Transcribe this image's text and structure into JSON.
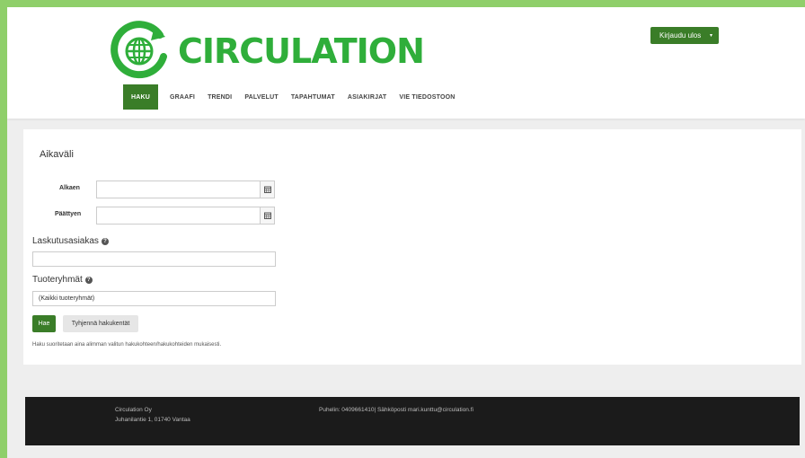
{
  "brand": {
    "name": "CIRCULATION",
    "logo_icon": "globe-arrow-icon",
    "color": "#2fae3a"
  },
  "account": {
    "logout_label": "Kirjaudu ulos",
    "caret": "▾"
  },
  "nav": {
    "items": [
      {
        "label": "HAKU",
        "active": true
      },
      {
        "label": "GRAAFI"
      },
      {
        "label": "TRENDI"
      },
      {
        "label": "PALVELUT"
      },
      {
        "label": "TAPAHTUMAT"
      },
      {
        "label": "ASIAKIRJAT"
      },
      {
        "label": "VIE TIEDOSTOON"
      }
    ]
  },
  "search": {
    "period_title": "Aikaväli",
    "start_label": "Alkaen",
    "start_value": "",
    "end_label": "Päättyen",
    "end_value": "",
    "calendar_icon": "calendar-icon",
    "customer_title": "Laskutusasiakas",
    "customer_value": "",
    "product_groups_title": "Tuoteryhmät",
    "product_groups_value": "(Kaikki tuoteryhmät)",
    "help_icon": "question-circle-icon",
    "search_button": "Hae",
    "clear_button": "Tyhjennä hakukentät",
    "note": "Haku suoritetaan aina alimman valitun hakukohteen/hakukohteiden mukaisesti."
  },
  "footer": {
    "company": "Circulation Oy",
    "address": "Juhanilantie 1, 01740 Vantaa",
    "contact": "Puhelin: 0409661410| Sähköposti mari.kunttu@circulation.fi"
  },
  "colors": {
    "accent": "#3a7d28",
    "border": "#8fcf6a",
    "footer_bg": "#1b1b1b"
  }
}
